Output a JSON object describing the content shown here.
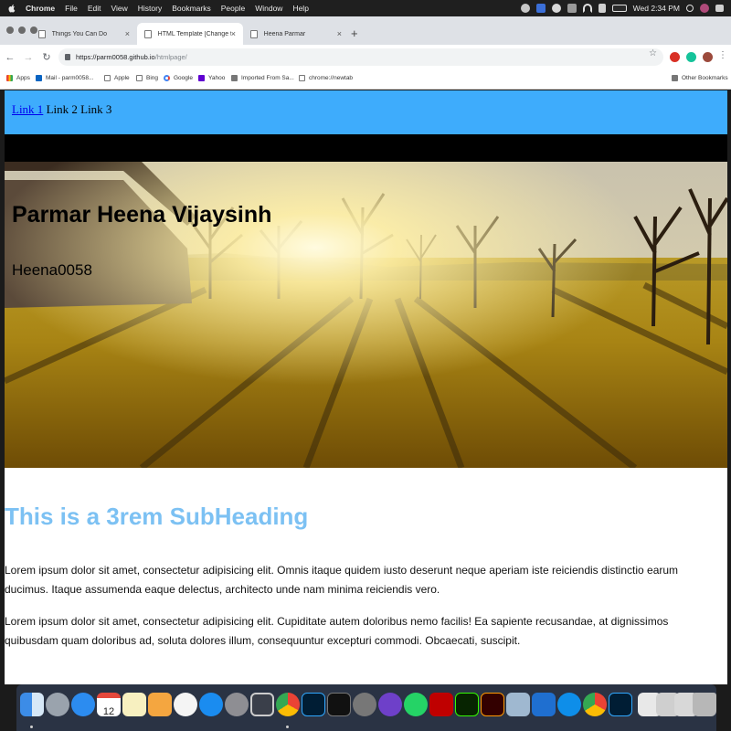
{
  "menubar": {
    "app_name": "Chrome",
    "items": [
      "File",
      "Edit",
      "View",
      "History",
      "Bookmarks",
      "People",
      "Window",
      "Help"
    ],
    "clock": "Wed 2:34 PM"
  },
  "tabs": [
    {
      "title": "Things You Can Do"
    },
    {
      "title": "HTML Template [Change this t"
    },
    {
      "title": "Heena Parmar"
    }
  ],
  "address": {
    "host": "https://parm0058.github.io",
    "path": "/htmlpage/"
  },
  "bookmarks": {
    "items": [
      "Apps",
      "Mail - parm0058...",
      "Apple",
      "Bing",
      "Google",
      "Yahoo",
      "Imported From Sa...",
      "chrome://newtab"
    ],
    "other": "Other Bookmarks"
  },
  "page": {
    "nav": {
      "link1": "Link 1",
      "link2": "Link 2",
      "link3": "Link 3"
    },
    "hero": {
      "name": "Parmar Heena Vijaysinh",
      "handle": "Heena0058"
    },
    "subheading": "This is a 3rem SubHeading",
    "paragraphs": [
      "Lorem ipsum dolor sit amet, consectetur adipisicing elit. Omnis itaque quidem iusto deserunt neque aperiam iste reiciendis distinctio earum ducimus. Itaque assumenda eaque delectus, architecto unde nam minima reiciendis vero.",
      "Lorem ipsum dolor sit amet, consectetur adipisicing elit. Cupiditate autem doloribus nemo facilis! Ea sapiente recusandae, at dignissimos quibusdam quam doloribus ad, soluta dolores illum, consequuntur excepturi commodi. Obcaecati, suscipit."
    ],
    "nav_color": "#3eacfc",
    "subheading_color": "#7cc1f3"
  },
  "dock": {
    "calendar_date": "12",
    "app_icons": [
      "finder",
      "launchpad",
      "safari",
      "calendar",
      "notes",
      "pages",
      "itunes",
      "app-store",
      "system-preferences",
      "preview",
      "chrome",
      "photoshop",
      "terminal",
      "settings",
      "github-desktop",
      "whatsapp",
      "filezilla",
      "dreamweaver",
      "illustrator",
      "image-capture",
      "xcode",
      "teamviewer",
      "chrome-alt",
      "photoshop-alt",
      "textedit",
      "illustrator-doc",
      "screenshots",
      "document",
      "document",
      "trash"
    ]
  }
}
